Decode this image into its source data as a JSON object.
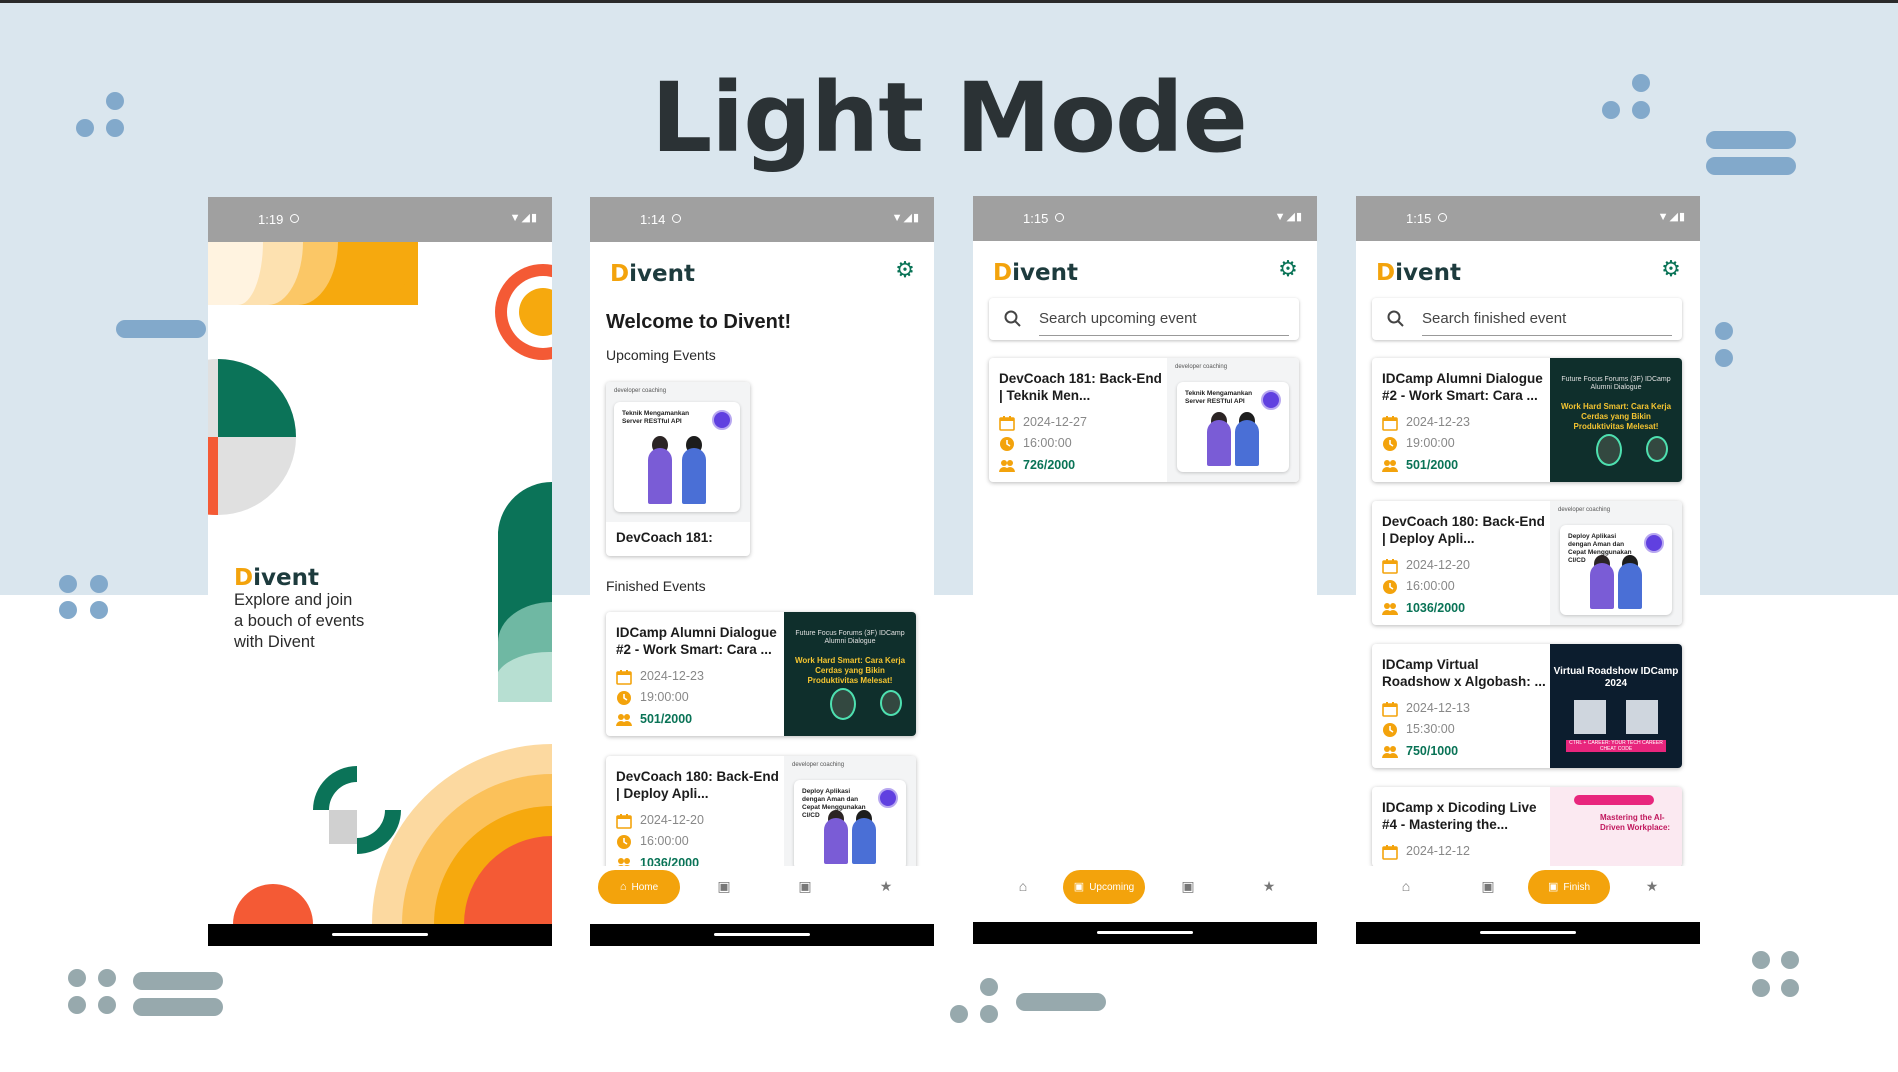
{
  "page": {
    "title": "Light Mode"
  },
  "colors": {
    "accent": "#f3a30c",
    "primary": "#097356",
    "band": "#dae6ee",
    "deco_blue": "#82a9cb",
    "deco_grey": "#97a9ad"
  },
  "app_name": "Divent",
  "logo": {
    "letter": "D",
    "rest": "ivent"
  },
  "phones": {
    "splash": {
      "time": "1:19",
      "tagline_1": "Explore and join",
      "tagline_2": "a bouch of events",
      "tagline_3": "with Divent"
    },
    "home": {
      "time": "1:14",
      "welcome": "Welcome to Divent!",
      "upcoming_label": "Upcoming Events",
      "finished_label": "Finished Events",
      "upcoming_card": {
        "title": "DevCoach 181:",
        "thumb_text": "Teknik Mengamankan Server RESTful API"
      },
      "finished": [
        {
          "title": "IDCamp Alumni Dialogue #2 - Work Smart: Cara ...",
          "date": "2024-12-23",
          "time": "19:00:00",
          "quota": "501/2000",
          "thumb_header": "Future Focus Forums (3F) IDCamp Alumni Dialogue",
          "thumb_text": "Work Hard Smart: Cara Kerja Cerdas yang Bikin Produktivitas Melesat!"
        },
        {
          "title": "DevCoach 180: Back-End | Deploy Apli...",
          "date": "2024-12-20",
          "time": "16:00:00",
          "quota": "1036/2000",
          "thumb_text": "Deploy Aplikasi dengan Aman dan Cepat Menggunakan CI/CD"
        }
      ],
      "nav_active_label": "Home"
    },
    "upcoming": {
      "time": "1:15",
      "search_placeholder": "Search upcoming event",
      "cards": [
        {
          "title": "DevCoach 181: Back-End | Teknik Men...",
          "date": "2024-12-27",
          "time": "16:00:00",
          "quota": "726/2000",
          "thumb_text": "Teknik Mengamankan Server RESTful API"
        }
      ],
      "nav_active_label": "Upcoming"
    },
    "finish": {
      "time": "1:15",
      "search_placeholder": "Search finished event",
      "cards": [
        {
          "title": "IDCamp Alumni Dialogue #2 - Work Smart: Cara ...",
          "date": "2024-12-23",
          "time": "19:00:00",
          "quota": "501/2000",
          "thumb_header": "Future Focus Forums (3F) IDCamp Alumni Dialogue",
          "thumb_text": "Work Hard Smart: Cara Kerja Cerdas yang Bikin Produktivitas Melesat!"
        },
        {
          "title": "DevCoach 180: Back-End | Deploy Apli...",
          "date": "2024-12-20",
          "time": "16:00:00",
          "quota": "1036/2000",
          "thumb_text": "Deploy Aplikasi dengan Aman dan Cepat Menggunakan CI/CD"
        },
        {
          "title": "IDCamp Virtual Roadshow x Algobash: ...",
          "date": "2024-12-13",
          "time": "15:30:00",
          "quota": "750/1000",
          "thumb_text": "Virtual Roadshow IDCamp 2024",
          "thumb_strip": "CTRL + CAREER: YOUR TECH CAREER CHEAT CODE"
        },
        {
          "title": "IDCamp x Dicoding Live #4 - Mastering the...",
          "date": "2024-12-12",
          "thumb_text": "Mastering the AI-Driven Workplace:"
        }
      ],
      "nav_active_label": "Finish"
    }
  }
}
